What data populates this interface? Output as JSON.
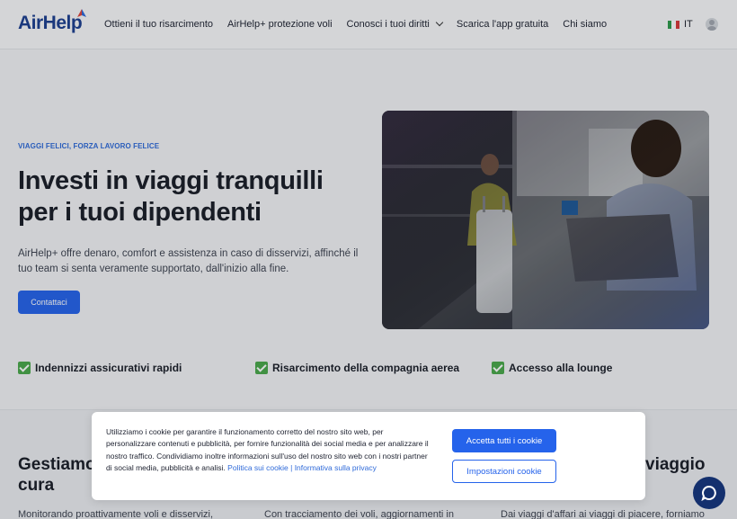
{
  "header": {
    "logo": "AirHelp",
    "nav": [
      {
        "label": "Ottieni il tuo risarcimento"
      },
      {
        "label": "AirHelp+ protezione voli"
      },
      {
        "label": "Conosci i tuoi diritti"
      },
      {
        "label": "Scarica l'app gratuita"
      },
      {
        "label": "Chi siamo"
      }
    ],
    "language": "IT",
    "icons": {
      "logo_mark": "paper-plane-icon",
      "dropdown": "chevron-down-icon",
      "flag": "italy-flag-icon",
      "user": "user-icon"
    },
    "colors": {
      "brand": "#1c3f8f",
      "accent": "#2563eb"
    }
  },
  "hero": {
    "eyebrow": "VIAGGI FELICI, FORZA LAVORO FELICE",
    "title_line1": "Investi in viaggi tranquilli",
    "title_line2": "per i tuoi dipendenti",
    "subtitle": "AirHelp+ offre denaro, comfort e assistenza in caso di disservizi, affinché il tuo team si senta veramente supportato, dall'inizio alla fine.",
    "cta": "Contattaci"
  },
  "features": [
    {
      "label": "Indennizzi assicurativi rapidi",
      "icon": "check-mark-icon"
    },
    {
      "label": "Risarcimento della compagnia aerea",
      "icon": "check-mark-icon"
    },
    {
      "label": "Accesso alla lounge",
      "icon": "check-mark-icon"
    }
  ],
  "section2": {
    "left_title_line1": "Gestiamo",
    "left_title_line2": "cura",
    "right_title_line1": "viaggio",
    "col1_text": "Monitorando proattivamente voli e disservizi,",
    "col2_text": "Con tracciamento dei voli, aggiornamenti in",
    "col3_text": "Dai viaggi d'affari ai viaggi di piacere, forniamo"
  },
  "cookie": {
    "text_main": "Utilizziamo i cookie per garantire il funzionamento corretto del nostro sito web, per personalizzare contenuti e pubblicità, per fornire funzionalità dei social media e per analizzare il nostro traffico. Condividiamo inoltre informazioni sull'uso del nostro sito web con i nostri partner di social media, pubblicità e analisi.",
    "link_cookie": "Politica sui cookie",
    "separator": "|",
    "link_privacy": "Informativa sulla privacy",
    "accept": "Accetta tutti i cookie",
    "settings": "Impostazioni cookie"
  },
  "chat": {
    "icon": "chat-bubble-icon"
  }
}
